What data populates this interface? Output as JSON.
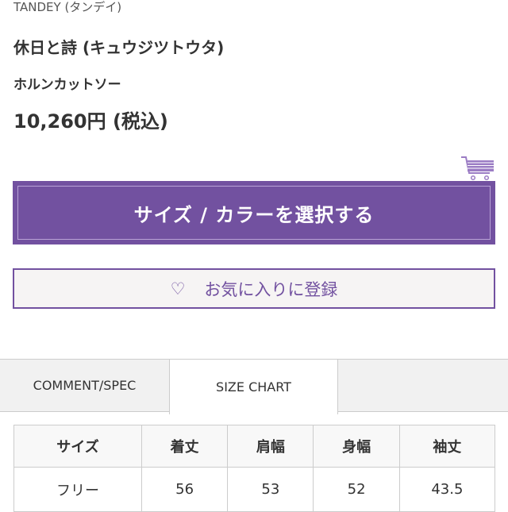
{
  "product": {
    "brand": "TANDEY (タンデイ)",
    "name": "休日と詩 (キュウジツトウタ)",
    "subtitle": "ホルンカットソー",
    "price": "10,260円 (税込)"
  },
  "actions": {
    "select_label": "サイズ / カラーを選択する",
    "favorite_label": "お気に入りに登録",
    "favorite_icon": "♡",
    "cart_icon": "cart-icon"
  },
  "colors": {
    "accent": "#7251a0"
  },
  "tabs": [
    {
      "label": "COMMENT/SPEC",
      "active": false
    },
    {
      "label": "SIZE CHART",
      "active": true
    },
    {
      "label": "",
      "active": false
    }
  ],
  "size_table": {
    "headers": [
      "サイズ",
      "着丈",
      "肩幅",
      "身幅",
      "袖丈"
    ],
    "rows": [
      [
        "フリー",
        "56",
        "53",
        "52",
        "43.5"
      ]
    ]
  }
}
